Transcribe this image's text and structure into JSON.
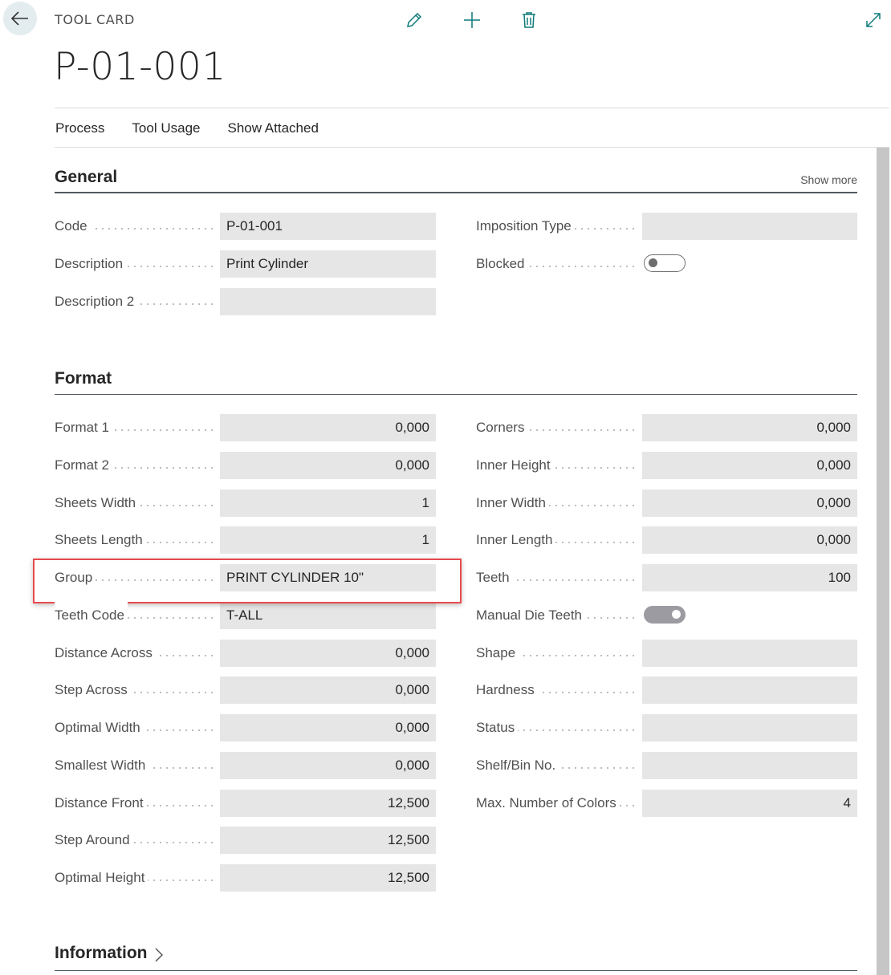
{
  "header": {
    "caption": "TOOL CARD",
    "title": "P-01-001"
  },
  "actions": [
    "Process",
    "Tool Usage",
    "Show Attached"
  ],
  "general": {
    "title": "General",
    "show_more": "Show more",
    "left": [
      {
        "label": "Code",
        "value": "P-01-001"
      },
      {
        "label": "Description",
        "value": "Print Cylinder"
      },
      {
        "label": "Description 2",
        "value": ""
      }
    ],
    "right": [
      {
        "label": "Imposition Type",
        "value": ""
      },
      {
        "label": "Blocked",
        "toggle": "off"
      }
    ]
  },
  "format": {
    "title": "Format",
    "left": [
      {
        "label": "Format 1",
        "value": "0,000"
      },
      {
        "label": "Format 2",
        "value": "0,000"
      },
      {
        "label": "Sheets Width",
        "value": "1"
      },
      {
        "label": "Sheets Length",
        "value": "1"
      },
      {
        "label": "Group",
        "value": "PRINT CYLINDER 10\""
      },
      {
        "label": "Teeth Code",
        "value": "T-ALL"
      },
      {
        "label": "Distance Across",
        "value": "0,000"
      },
      {
        "label": "Step Across",
        "value": "0,000"
      },
      {
        "label": "Optimal Width",
        "value": "0,000"
      },
      {
        "label": "Smallest Width",
        "value": "0,000"
      },
      {
        "label": "Distance Front",
        "value": "12,500"
      },
      {
        "label": "Step Around",
        "value": "12,500"
      },
      {
        "label": "Optimal Height",
        "value": "12,500"
      }
    ],
    "right": [
      {
        "label": "Corners",
        "value": "0,000"
      },
      {
        "label": "Inner Height",
        "value": "0,000"
      },
      {
        "label": "Inner Width",
        "value": "0,000"
      },
      {
        "label": "Inner Length",
        "value": "0,000"
      },
      {
        "label": "Teeth",
        "value": "100"
      },
      {
        "label": "Manual Die Teeth",
        "toggle": "on"
      },
      {
        "label": "Shape",
        "value": ""
      },
      {
        "label": "Hardness",
        "value": ""
      },
      {
        "label": "Status",
        "value": ""
      },
      {
        "label": "Shelf/Bin No.",
        "value": ""
      },
      {
        "label": "Max. Number of Colors",
        "value": "4"
      }
    ]
  },
  "information": {
    "title": "Information"
  },
  "colors": {
    "accent": "#0f7a7a",
    "highlight": "#e84a4d",
    "field_bg": "#e6e6e6"
  },
  "icons": [
    "back-arrow-icon",
    "edit-pencil-icon",
    "add-plus-icon",
    "delete-trash-icon",
    "expand-icon",
    "chevron-right-icon"
  ]
}
